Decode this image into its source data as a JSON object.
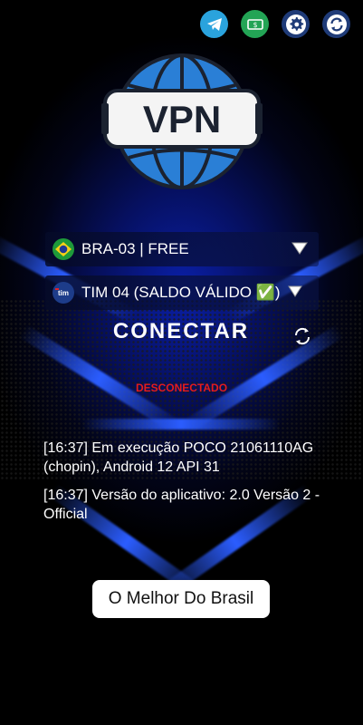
{
  "topbar": {
    "icons": [
      "telegram-icon",
      "money-icon",
      "gear-icon",
      "refresh-icon"
    ]
  },
  "logo": {
    "text": "VPN"
  },
  "server": {
    "flag": "brazil-flag-icon",
    "label": "BRA-03 | FREE"
  },
  "payload": {
    "flag": "tim-logo-icon",
    "label": "TIM 04 (SALDO VÁLIDO ✅)"
  },
  "connect": {
    "label": "CONECTAR"
  },
  "status": {
    "text": "DESCONECTADO",
    "color": "#e51c1c"
  },
  "log": {
    "lines": [
      "[16:37] Em execução POCO 21061110AG (chopin), Android 12 API 31",
      "[16:37] Versão do aplicativo: 2.0 Versão 2 - Official"
    ]
  },
  "footer": {
    "button_label": "O Melhor Do Brasil"
  },
  "colors": {
    "accent_blue": "#2b5dff",
    "telegram": "#2aa3dd",
    "money": "#23a455"
  }
}
